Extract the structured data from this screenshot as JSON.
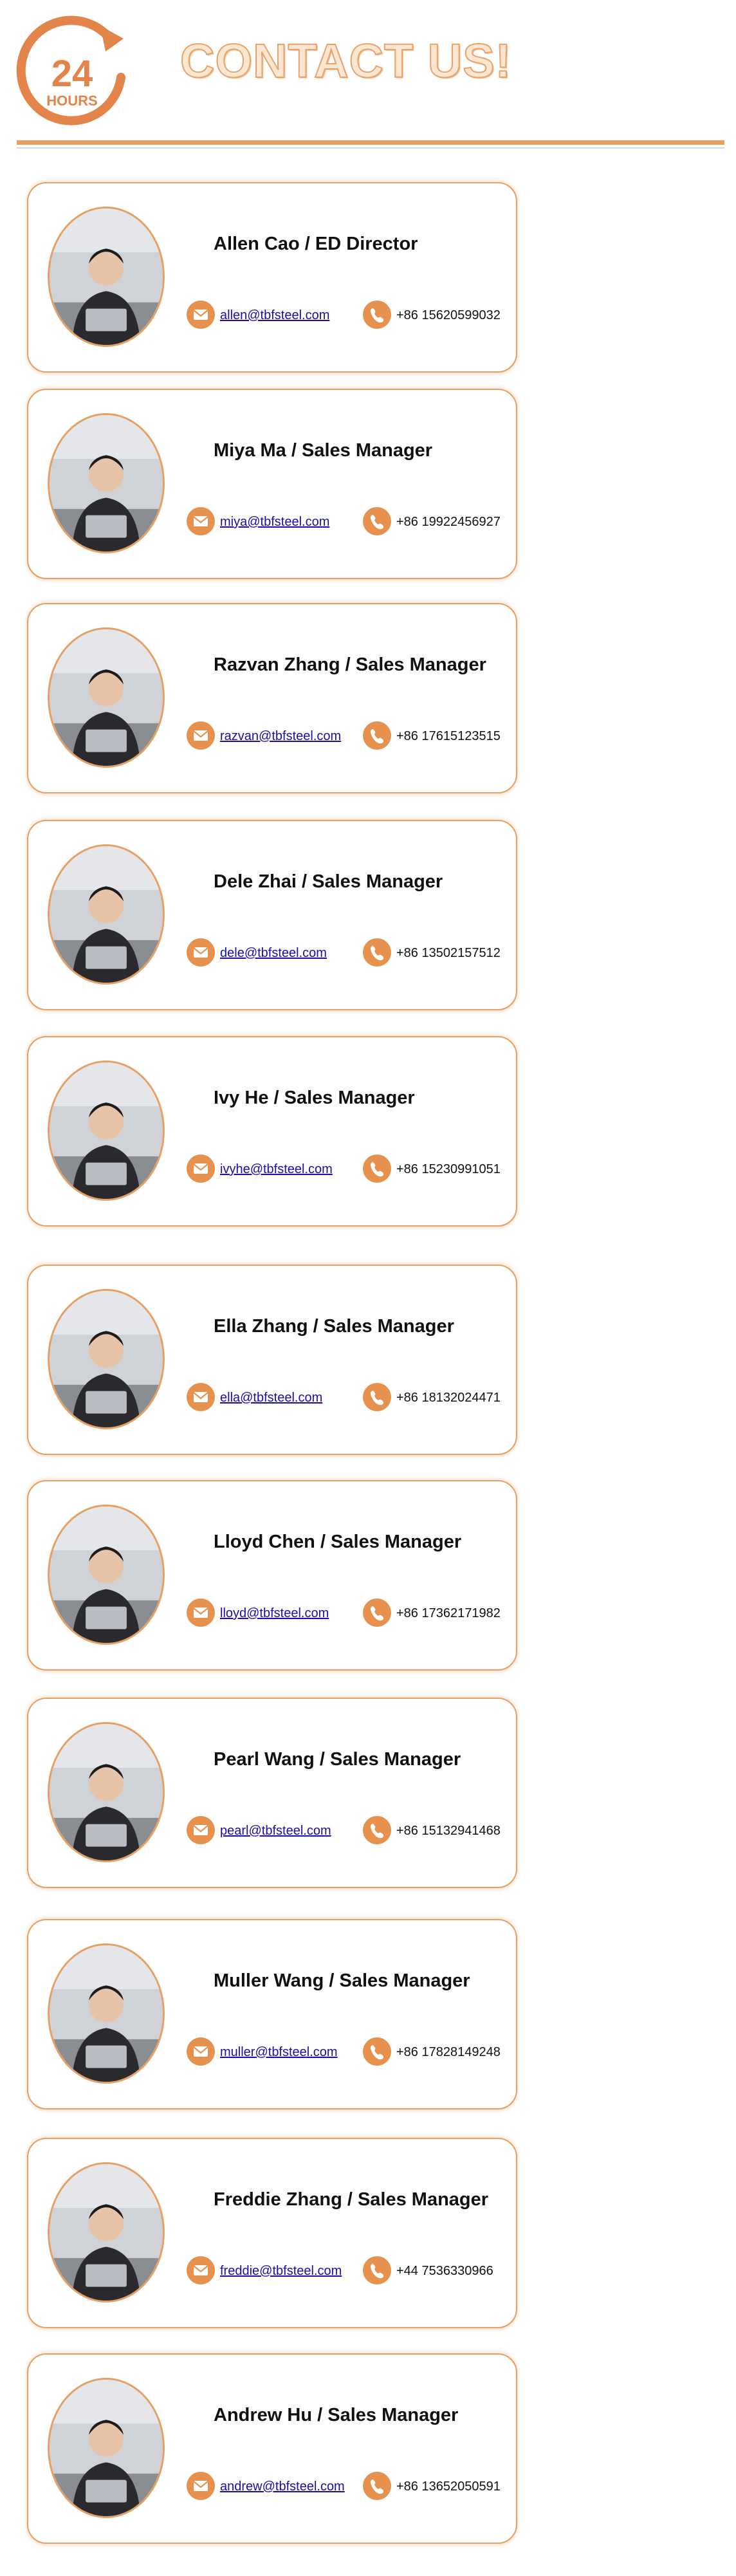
{
  "header": {
    "logo_number": "24",
    "logo_word": "HOURS",
    "title": "CONTACT US!"
  },
  "colors": {
    "accent": "#e6914e",
    "card_border": "#e6a063",
    "link": "#1a0dab"
  },
  "contacts": [
    {
      "name": "Allen Cao / ED Director",
      "email": "allen@tbfsteel.com",
      "phone": "+86 15620599032"
    },
    {
      "name": "Miya Ma / Sales Manager",
      "email": "miya@tbfsteel.com",
      "phone": "+86 19922456927"
    },
    {
      "name": "Razvan Zhang / Sales Manager",
      "email": "razvan@tbfsteel.com",
      "phone": "+86 17615123515"
    },
    {
      "name": "Dele Zhai / Sales Manager",
      "email": "dele@tbfsteel.com",
      "phone": "+86 13502157512"
    },
    {
      "name": "Ivy He / Sales Manager",
      "email": "ivyhe@tbfsteel.com",
      "phone": "+86 15230991051"
    },
    {
      "name": "Ella Zhang / Sales Manager",
      "email": "ella@tbfsteel.com",
      "phone": "+86 18132024471"
    },
    {
      "name": "Lloyd Chen / Sales Manager",
      "email": "lloyd@tbfsteel.com",
      "phone": "+86 17362171982"
    },
    {
      "name": "Pearl Wang / Sales Manager",
      "email": "pearl@tbfsteel.com",
      "phone": "+86 15132941468"
    },
    {
      "name": "Muller Wang / Sales Manager",
      "email": "muller@tbfsteel.com",
      "phone": "+86 17828149248"
    },
    {
      "name": "Freddie Zhang / Sales Manager",
      "email": "freddie@tbfsteel.com",
      "phone": "+44 7536330966"
    },
    {
      "name": "Andrew Hu / Sales Manager",
      "email": "andrew@tbfsteel.com",
      "phone": "+86 13652050591"
    }
  ]
}
